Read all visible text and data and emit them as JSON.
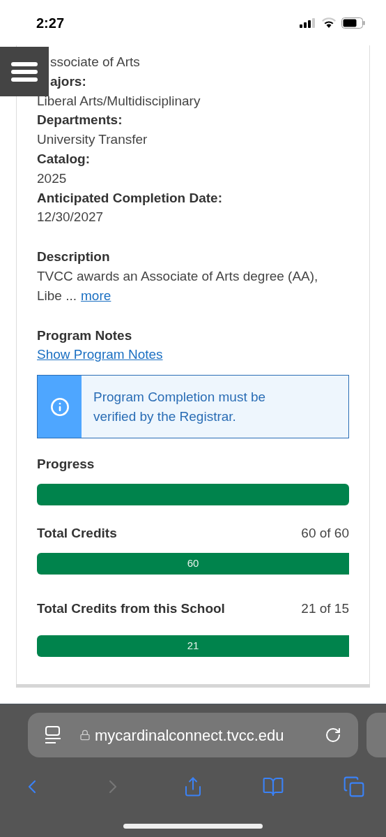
{
  "status_bar": {
    "time": "2:27"
  },
  "details": [
    {
      "kind": "value",
      "text": "ssociate of Arts",
      "partly_hidden": true
    },
    {
      "kind": "label",
      "text": "ajors:",
      "partly_hidden": true
    },
    {
      "kind": "value",
      "text": "Liberal Arts/Multidisciplinary",
      "partly_hidden": false
    },
    {
      "kind": "label",
      "text": "Departments:",
      "partly_hidden": false
    },
    {
      "kind": "value",
      "text": "University Transfer",
      "partly_hidden": false
    },
    {
      "kind": "label",
      "text": "Catalog:",
      "partly_hidden": false
    },
    {
      "kind": "value",
      "text": "2025",
      "partly_hidden": false
    },
    {
      "kind": "label",
      "text": "Anticipated Completion Date:",
      "partly_hidden": false
    },
    {
      "kind": "value",
      "text": "12/30/2027",
      "partly_hidden": false
    }
  ],
  "description": {
    "heading": "Description",
    "text": "TVCC awards an Associate of Arts degree (AA),",
    "text_cont": "Libe ...",
    "more_link": "more"
  },
  "program_notes": {
    "heading": "Program Notes",
    "link": "Show Program Notes"
  },
  "alert": {
    "text": "Program Completion must be verified by the Registrar."
  },
  "progress": {
    "heading": "Progress",
    "level": 1
  },
  "credit_bars": [
    {
      "label": "Total Credits",
      "reading": "60 of 60",
      "bar_label": "60",
      "level": 1
    },
    {
      "label": "Total Credits from this School",
      "reading": "21 of 15",
      "bar_label": "21",
      "level": 1
    }
  ],
  "browser": {
    "url": "mycardinalconnect.tvcc.edu"
  }
}
